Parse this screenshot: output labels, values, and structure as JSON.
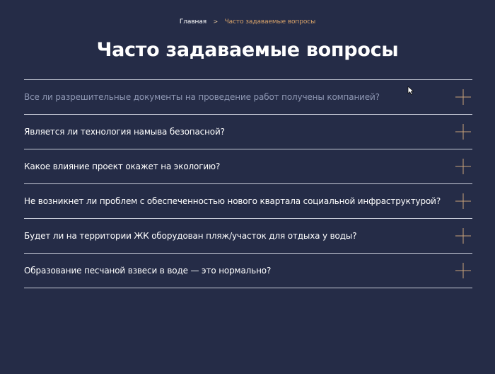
{
  "breadcrumb": {
    "home": "Главная",
    "separator": ">",
    "current": "Часто задаваемые вопросы"
  },
  "page": {
    "title": "Часто задаваемые вопросы"
  },
  "faq": {
    "items": [
      {
        "question": "Все ли разрешительные документы на проведение работ получены компанией?",
        "icon": "plus-icon"
      },
      {
        "question": "Является ли технология намыва безопасной?",
        "icon": "plus-icon"
      },
      {
        "question": "Какое влияние проект окажет на экологию?",
        "icon": "plus-icon"
      },
      {
        "question": "Не возникнет ли проблем с обеспеченностью нового квартала социальной инфраструктурой?",
        "icon": "plus-icon"
      },
      {
        "question": "Будет ли на территории ЖК оборудован пляж/участок для отдыха у воды?",
        "icon": "plus-icon"
      },
      {
        "question": "Образование песчаной взвеси в воде — это нормально?",
        "icon": "plus-icon"
      }
    ]
  },
  "colors": {
    "background": "#252c47",
    "accent": "#d9a36a",
    "divider": "#c8ccd8",
    "muted_text": "#8e97b3"
  }
}
